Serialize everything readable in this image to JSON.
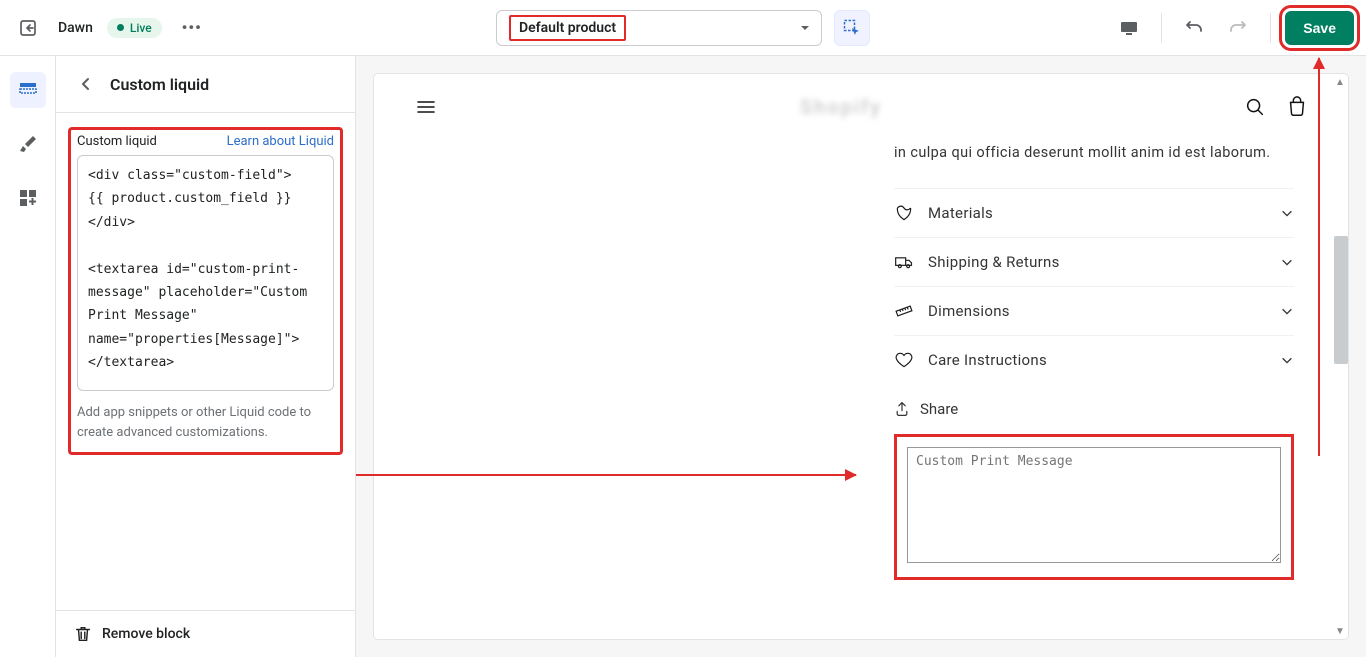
{
  "topbar": {
    "theme_name": "Dawn",
    "live_label": "Live",
    "template_label": "Default product",
    "save_label": "Save"
  },
  "sidebar": {
    "title": "Custom liquid",
    "field_label": "Custom liquid",
    "learn_link": "Learn about Liquid",
    "code": "<div class=\"custom-field\">\n{{ product.custom_field }}\n</div>\n\n<textarea id=\"custom-print-message\" placeholder=\"Custom Print Message\" name=\"properties[Message]\">\n</textarea>",
    "help": "Add app snippets or other Liquid code to create advanced customizations.",
    "remove_label": "Remove block"
  },
  "preview": {
    "logo_placeholder": "Shopify",
    "description": "in culpa qui officia deserunt mollit anim id est laborum.",
    "accordion": {
      "materials": "Materials",
      "shipping": "Shipping & Returns",
      "dimensions": "Dimensions",
      "care": "Care Instructions"
    },
    "share_label": "Share",
    "textarea_placeholder": "Custom Print Message"
  }
}
